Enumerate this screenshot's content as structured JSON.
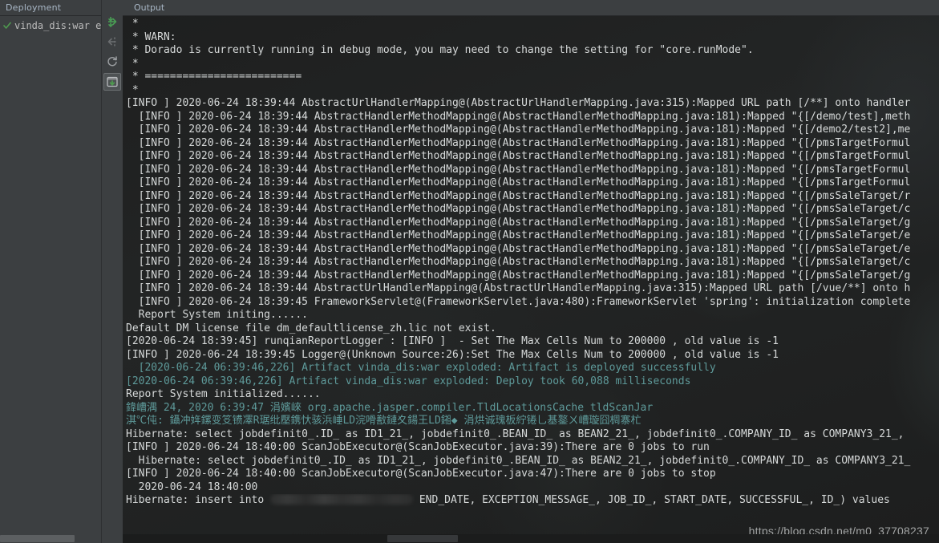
{
  "deployment_panel": {
    "tab_label": "Deployment",
    "tree": [
      {
        "status_icon": "green-check-icon",
        "label": "vinda_dis:war ex"
      }
    ]
  },
  "toolbar": {
    "buttons": [
      {
        "icon": "deploy-arrows-icon",
        "name": "deploy-button",
        "enabled": true,
        "selected": false
      },
      {
        "icon": "undeploy-arrow-icon",
        "name": "undeploy-button",
        "enabled": false,
        "selected": false
      },
      {
        "icon": "redeploy-refresh-icon",
        "name": "redeploy-button",
        "enabled": true,
        "selected": false
      },
      {
        "icon": "scroll-to-end-icon",
        "name": "scroll-to-end-button",
        "enabled": true,
        "selected": true
      }
    ]
  },
  "output_panel": {
    "tab_label": "Output",
    "watermark": "https://blog.csdn.net/m0_37708237",
    "colors": {
      "background": "#232525",
      "text": "#d6d9d9",
      "teal": "#5e9a9a",
      "red": "#c75450",
      "panel": "#3c3f41",
      "accent_green": "#499c54"
    },
    "lines": [
      {
        "color": "white",
        "text": " *"
      },
      {
        "color": "white",
        "text": " * WARN:"
      },
      {
        "color": "white",
        "text": " * Dorado is currently running in debug mode, you may need to change the setting for \"core.runMode\"."
      },
      {
        "color": "white",
        "text": " *"
      },
      {
        "color": "white",
        "text": " * ========================="
      },
      {
        "color": "white",
        "text": " *"
      },
      {
        "color": "white",
        "text": "[INFO ] 2020-06-24 18:39:44 AbstractUrlHandlerMapping@(AbstractUrlHandlerMapping.java:315):Mapped URL path [/**] onto handler"
      },
      {
        "color": "white",
        "text": "  [INFO ] 2020-06-24 18:39:44 AbstractHandlerMethodMapping@(AbstractHandlerMethodMapping.java:181):Mapped \"{[/demo/test],meth"
      },
      {
        "color": "white",
        "text": "  [INFO ] 2020-06-24 18:39:44 AbstractHandlerMethodMapping@(AbstractHandlerMethodMapping.java:181):Mapped \"{[/demo2/test2],me"
      },
      {
        "color": "white",
        "text": "  [INFO ] 2020-06-24 18:39:44 AbstractHandlerMethodMapping@(AbstractHandlerMethodMapping.java:181):Mapped \"{[/pmsTargetFormul"
      },
      {
        "color": "white",
        "text": "  [INFO ] 2020-06-24 18:39:44 AbstractHandlerMethodMapping@(AbstractHandlerMethodMapping.java:181):Mapped \"{[/pmsTargetFormul"
      },
      {
        "color": "white",
        "text": "  [INFO ] 2020-06-24 18:39:44 AbstractHandlerMethodMapping@(AbstractHandlerMethodMapping.java:181):Mapped \"{[/pmsTargetFormul"
      },
      {
        "color": "white",
        "text": "  [INFO ] 2020-06-24 18:39:44 AbstractHandlerMethodMapping@(AbstractHandlerMethodMapping.java:181):Mapped \"{[/pmsTargetFormul"
      },
      {
        "color": "white",
        "text": "  [INFO ] 2020-06-24 18:39:44 AbstractHandlerMethodMapping@(AbstractHandlerMethodMapping.java:181):Mapped \"{[/pmsSaleTarget/r"
      },
      {
        "color": "white",
        "text": "  [INFO ] 2020-06-24 18:39:44 AbstractHandlerMethodMapping@(AbstractHandlerMethodMapping.java:181):Mapped \"{[/pmsSaleTarget/c"
      },
      {
        "color": "white",
        "text": "  [INFO ] 2020-06-24 18:39:44 AbstractHandlerMethodMapping@(AbstractHandlerMethodMapping.java:181):Mapped \"{[/pmsSaleTarget/g"
      },
      {
        "color": "white",
        "text": "  [INFO ] 2020-06-24 18:39:44 AbstractHandlerMethodMapping@(AbstractHandlerMethodMapping.java:181):Mapped \"{[/pmsSaleTarget/e"
      },
      {
        "color": "white",
        "text": "  [INFO ] 2020-06-24 18:39:44 AbstractHandlerMethodMapping@(AbstractHandlerMethodMapping.java:181):Mapped \"{[/pmsSaleTarget/e"
      },
      {
        "color": "white",
        "text": "  [INFO ] 2020-06-24 18:39:44 AbstractHandlerMethodMapping@(AbstractHandlerMethodMapping.java:181):Mapped \"{[/pmsSaleTarget/c"
      },
      {
        "color": "white",
        "text": "  [INFO ] 2020-06-24 18:39:44 AbstractHandlerMethodMapping@(AbstractHandlerMethodMapping.java:181):Mapped \"{[/pmsSaleTarget/g"
      },
      {
        "color": "white",
        "text": "  [INFO ] 2020-06-24 18:39:44 AbstractUrlHandlerMapping@(AbstractUrlHandlerMapping.java:315):Mapped URL path [/vue/**] onto h"
      },
      {
        "color": "white",
        "text": "  [INFO ] 2020-06-24 18:39:45 FrameworkServlet@(FrameworkServlet.java:480):FrameworkServlet 'spring': initialization complete"
      },
      {
        "color": "white",
        "text": "  Report System initing......"
      },
      {
        "color": "white",
        "text": "Default DM license file dm_defaultlicense_zh.lic not exist."
      },
      {
        "color": "white",
        "text": "[2020-06-24 18:39:45] runqianReportLogger : [INFO ]  - Set The Max Cells Num to 200000 , old value is -1"
      },
      {
        "color": "white",
        "text": "[INFO ] 2020-06-24 18:39:45 Logger@(Unknown Source:26):Set The Max Cells Num to 200000 , old value is -1"
      },
      {
        "color": "teal",
        "text": "  [2020-06-24 06:39:46,226] Artifact vinda_dis:war exploded: Artifact is deployed successfully"
      },
      {
        "color": "teal",
        "text": "[2020-06-24 06:39:46,226] Artifact vinda_dis:war exploded: Deploy took 60,088 milliseconds"
      },
      {
        "color": "white",
        "text": "Report System initialized......"
      },
      {
        "color": "teal",
        "text": "鍏嶆湡 24, 2020 6:39:47 涓嬪崍 org.apache.jasper.compiler.TldLocationsCache tldScanJar"
      },
      {
        "color": "teal",
        "text": "淇℃伅: 鑷冲姩鏍变笅镄凙R琚纰壓鎸忕骇浜崜LD浣嗗敾鏈夊鍚王LD鎺◆ 涓烘诚瑰板紵锩乚基鐜ㄨ嶆璇囧椆寨杧"
      },
      {
        "color": "white",
        "text": "Hibernate: select jobdefinit0_.ID_ as ID1_21_, jobdefinit0_.BEAN_ID_ as BEAN2_21_, jobdefinit0_.COMPANY_ID_ as COMPANY3_21_,"
      },
      {
        "color": "white",
        "text": "[INFO ] 2020-06-24 18:40:00 ScanJobExecutor@(ScanJobExecutor.java:39):There are 0 jobs to run"
      },
      {
        "color": "white",
        "text": "  Hibernate: select jobdefinit0_.ID_ as ID1_21_, jobdefinit0_.BEAN_ID_ as BEAN2_21_, jobdefinit0_.COMPANY_ID_ as COMPANY3_21_"
      },
      {
        "color": "white",
        "text": "[INFO ] 2020-06-24 18:40:00 ScanJobExecutor@(ScanJobExecutor.java:47):There are 0 jobs to stop"
      },
      {
        "color": "white",
        "text": "  2020-06-24 18:40:00"
      },
      {
        "color": "white",
        "redacted": true,
        "prefix": "Hibernate: insert into ",
        "suffix": " END_DATE, EXCEPTION_MESSAGE_, JOB_ID_, START_DATE, SUCCESSFUL_, ID_) values"
      }
    ]
  }
}
